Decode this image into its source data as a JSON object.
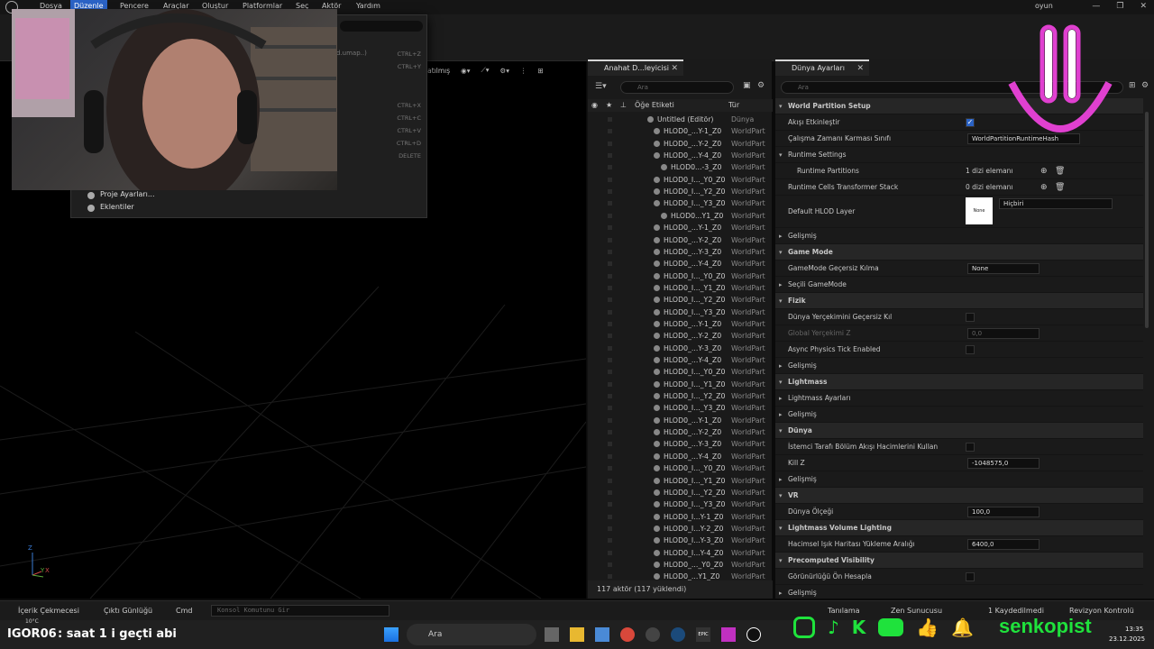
{
  "colors": {
    "accent": "#2a62c4",
    "overlay_pink": "#e040d0",
    "overlay_green": "#1fe23c",
    "checkbox_blue": "#2a62c4"
  },
  "menu": {
    "items": [
      "Dosya",
      "Düzenle",
      "Pencere",
      "Araçlar",
      "Oluştur",
      "Platformlar",
      "Seç",
      "Aktör",
      "Yardım"
    ],
    "project_name": "oyun"
  },
  "editmenu": {
    "partial_text": "d.umap..)",
    "shortcuts": [
      "CTRL+Z",
      "CTRL+Y",
      "CTRL+X",
      "CTRL+C",
      "CTRL+V",
      "CTRL+D",
      "DELETE"
    ],
    "project_settings": "Proje Ayarları...",
    "plugins": "Eklentiler"
  },
  "viewport": {
    "mode_label": "ılatılmış",
    "axis_z": "Z",
    "axis_y": "Y",
    "axis_x": "X"
  },
  "outliner": {
    "tab_title": "Anahat D...leyicisi",
    "search_placeholder": "Ara",
    "col_label": "Öğe Etiketi",
    "col_type": "Tür",
    "rows": [
      {
        "label": "Untitled (Editör)",
        "type": "Dünya",
        "indent": 0
      },
      {
        "label": "HLOD0_...Y-1_Z0",
        "type": "WorldPart",
        "indent": 1
      },
      {
        "label": "HLOD0_...Y-2_Z0",
        "type": "WorldPart",
        "indent": 1
      },
      {
        "label": "HLOD0_...Y-4_Z0",
        "type": "WorldPart",
        "indent": 1
      },
      {
        "label": "HLOD0...-3_Z0",
        "type": "WorldPart",
        "indent": 2
      },
      {
        "label": "HLOD0_I..._Y0_Z0",
        "type": "WorldPart",
        "indent": 1
      },
      {
        "label": "HLOD0_I..._Y2_Z0",
        "type": "WorldPart",
        "indent": 1
      },
      {
        "label": "HLOD0_I..._Y3_Z0",
        "type": "WorldPart",
        "indent": 1
      },
      {
        "label": "HLOD0...Y1_Z0",
        "type": "WorldPart",
        "indent": 2
      },
      {
        "label": "HLOD0_...Y-1_Z0",
        "type": "WorldPart",
        "indent": 1
      },
      {
        "label": "HLOD0_...Y-2_Z0",
        "type": "WorldPart",
        "indent": 1
      },
      {
        "label": "HLOD0_...Y-3_Z0",
        "type": "WorldPart",
        "indent": 1
      },
      {
        "label": "HLOD0_...Y-4_Z0",
        "type": "WorldPart",
        "indent": 1
      },
      {
        "label": "HLOD0_I..._Y0_Z0",
        "type": "WorldPart",
        "indent": 1
      },
      {
        "label": "HLOD0_I..._Y1_Z0",
        "type": "WorldPart",
        "indent": 1
      },
      {
        "label": "HLOD0_I..._Y2_Z0",
        "type": "WorldPart",
        "indent": 1
      },
      {
        "label": "HLOD0_I..._Y3_Z0",
        "type": "WorldPart",
        "indent": 1
      },
      {
        "label": "HLOD0_...Y-1_Z0",
        "type": "WorldPart",
        "indent": 1
      },
      {
        "label": "HLOD0_...Y-2_Z0",
        "type": "WorldPart",
        "indent": 1
      },
      {
        "label": "HLOD0_...Y-3_Z0",
        "type": "WorldPart",
        "indent": 1
      },
      {
        "label": "HLOD0_...Y-4_Z0",
        "type": "WorldPart",
        "indent": 1
      },
      {
        "label": "HLOD0_I..._Y0_Z0",
        "type": "WorldPart",
        "indent": 1
      },
      {
        "label": "HLOD0_I..._Y1_Z0",
        "type": "WorldPart",
        "indent": 1
      },
      {
        "label": "HLOD0_I..._Y2_Z0",
        "type": "WorldPart",
        "indent": 1
      },
      {
        "label": "HLOD0_I..._Y3_Z0",
        "type": "WorldPart",
        "indent": 1
      },
      {
        "label": "HLOD0_...Y-1_Z0",
        "type": "WorldPart",
        "indent": 1
      },
      {
        "label": "HLOD0_...Y-2_Z0",
        "type": "WorldPart",
        "indent": 1
      },
      {
        "label": "HLOD0_...Y-3_Z0",
        "type": "WorldPart",
        "indent": 1
      },
      {
        "label": "HLOD0_...Y-4_Z0",
        "type": "WorldPart",
        "indent": 1
      },
      {
        "label": "HLOD0_I..._Y0_Z0",
        "type": "WorldPart",
        "indent": 1
      },
      {
        "label": "HLOD0_I..._Y1_Z0",
        "type": "WorldPart",
        "indent": 1
      },
      {
        "label": "HLOD0_I..._Y2_Z0",
        "type": "WorldPart",
        "indent": 1
      },
      {
        "label": "HLOD0_I..._Y3_Z0",
        "type": "WorldPart",
        "indent": 1
      },
      {
        "label": "HLOD0_I...Y-1_Z0",
        "type": "WorldPart",
        "indent": 1
      },
      {
        "label": "HLOD0_I...Y-2_Z0",
        "type": "WorldPart",
        "indent": 1
      },
      {
        "label": "HLOD0_I...Y-3_Z0",
        "type": "WorldPart",
        "indent": 1
      },
      {
        "label": "HLOD0_I...Y-4_Z0",
        "type": "WorldPart",
        "indent": 1
      },
      {
        "label": "HLOD0_..._Y0_Z0",
        "type": "WorldPart",
        "indent": 1
      },
      {
        "label": "HLOD0_...Y1_Z0",
        "type": "WorldPart",
        "indent": 1
      }
    ],
    "footer": "117 aktör (117 yüklendi)"
  },
  "details": {
    "tab_title": "Dünya Ayarları",
    "search_placeholder": "Ara",
    "rows": [
      {
        "kind": "cat",
        "label": "World Partition Setup"
      },
      {
        "kind": "check",
        "label": "Akışı Etkinleştir",
        "checked": true
      },
      {
        "kind": "field",
        "label": "Çalışma Zamanı Karması Sınıfı",
        "value": "WorldPartitionRuntimeHash"
      },
      {
        "kind": "sub",
        "label": "Runtime Settings"
      },
      {
        "kind": "text",
        "label": "Runtime Partitions",
        "value": "1 dizi elemanı",
        "expand": true
      },
      {
        "kind": "text",
        "label": "Runtime Cells Transformer Stack",
        "value": "0 dizi elemanı"
      },
      {
        "kind": "hlod",
        "label": "Default HLOD Layer",
        "value": "Hiçbiri",
        "thumb": "None"
      },
      {
        "kind": "adv",
        "label": "Gelişmiş"
      },
      {
        "kind": "cat",
        "label": "Game Mode"
      },
      {
        "kind": "combo",
        "label": "GameMode Geçersiz Kılma",
        "value": "None"
      },
      {
        "kind": "adv",
        "label": "Seçili GameMode"
      },
      {
        "kind": "cat",
        "label": "Fizik"
      },
      {
        "kind": "check",
        "label": "Dünya Yerçekimini Geçersiz Kıl",
        "checked": false
      },
      {
        "kind": "field",
        "label": "Global Yerçekimi Z",
        "value": "0,0",
        "disabled": true
      },
      {
        "kind": "check",
        "label": "Async Physics Tick Enabled",
        "checked": false
      },
      {
        "kind": "adv",
        "label": "Gelişmiş"
      },
      {
        "kind": "cat",
        "label": "Lightmass"
      },
      {
        "kind": "adv",
        "label": "Lightmass Ayarları"
      },
      {
        "kind": "adv",
        "label": "Gelişmiş"
      },
      {
        "kind": "cat",
        "label": "Dünya"
      },
      {
        "kind": "check",
        "label": "İstemci Tarafı Bölüm Akışı Hacimlerini Kullan",
        "checked": false
      },
      {
        "kind": "field",
        "label": "Kill Z",
        "value": "-1048575,0"
      },
      {
        "kind": "adv",
        "label": "Gelişmiş"
      },
      {
        "kind": "cat",
        "label": "VR"
      },
      {
        "kind": "field",
        "label": "Dünya Ölçeği",
        "value": "100,0"
      },
      {
        "kind": "cat",
        "label": "Lightmass Volume Lighting"
      },
      {
        "kind": "field",
        "label": "Hacimsel Işık Haritası Yükleme Aralığı",
        "value": "6400,0"
      },
      {
        "kind": "cat",
        "label": "Precomputed Visibility"
      },
      {
        "kind": "check",
        "label": "Görünürlüğü Ön Hesapla",
        "checked": false
      },
      {
        "kind": "adv",
        "label": "Gelişmiş"
      }
    ]
  },
  "statusbar": {
    "content_drawer": "İçerik Çekmecesi",
    "output_log": "Çıktı Günlüğü",
    "cmd": "Cmd",
    "console_placeholder": "Konsol Komutunu Gir",
    "trace": "Tanılama",
    "zen": "Zen Sunucusu",
    "saved": "1 Kaydedilmedi",
    "revision": "Revizyon Kontrolü",
    "count": "2"
  },
  "taskbar": {
    "chat_user": "IGOR06",
    "chat_text": ": saat 1 i geçti abi",
    "temp": "10°C",
    "search": "Ara",
    "time": "13:35",
    "date": "23.12.2025",
    "brand": "senkopist",
    "epic": "EPIC"
  }
}
